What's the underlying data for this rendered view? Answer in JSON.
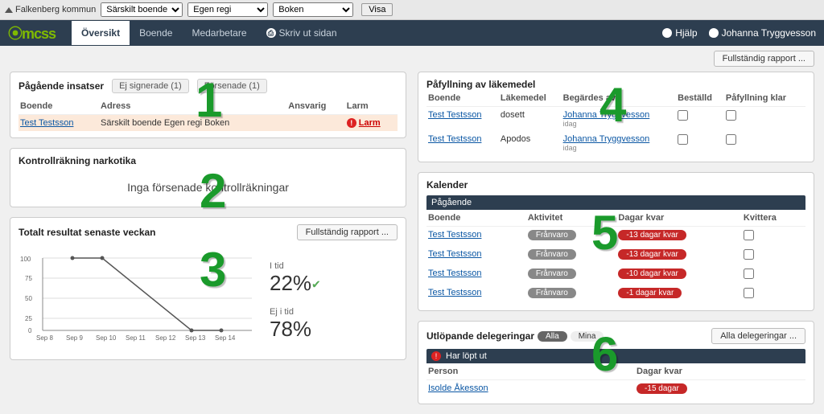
{
  "top": {
    "crumb": "Falkenberg kommun",
    "sel1": "Särskilt boende",
    "sel2": "Egen regi",
    "sel3": "Boken",
    "visa": "Visa"
  },
  "nav": {
    "logo": "⦿mcss",
    "tab1": "Översikt",
    "tab2": "Boende",
    "tab3": "Medarbetare",
    "tab4": "Skriv ut sidan",
    "help": "Hjälp",
    "user": "Johanna Tryggvesson"
  },
  "top_report": "Fullständig rapport ...",
  "p1": {
    "title": "Pågående insatser",
    "bt1": "Ej signerade (1)",
    "bt2": "Försenade (1)",
    "h_boende": "Boende",
    "h_adress": "Adress",
    "h_ansv": "Ansvarig",
    "h_larm": "Larm",
    "name": "Test Testsson",
    "addr": "Särskilt boende Egen regi Boken",
    "larm": "Larm"
  },
  "p2": {
    "title": "Kontrollräkning narkotika",
    "msg": "Inga försenade kontrollräkningar"
  },
  "p3": {
    "title": "Totalt resultat senaste veckan",
    "btn": "Fullständig rapport ...",
    "l1": "I tid",
    "v1": "22%",
    "l2": "Ej i tid",
    "v2": "78%"
  },
  "p4": {
    "title": "Påfyllning av läkemedel",
    "h1": "Boende",
    "h2": "Läkemedel",
    "h3": "Begärdes av",
    "h4": "Beställd",
    "h5": "Påfyllning klar",
    "name": "Test Testsson",
    "med1": "dosett",
    "med2": "Apodos",
    "by": "Johanna Tryggvesson",
    "sub": "idag"
  },
  "p5": {
    "title": "Kalender",
    "sect": "Pågående",
    "h1": "Boende",
    "h2": "Aktivitet",
    "h3": "Dagar kvar",
    "h4": "Kvittera",
    "name": "Test Testsson",
    "act": "Frånvaro",
    "d1": "-13 dagar kvar",
    "d2": "-13 dagar kvar",
    "d3": "-10 dagar kvar",
    "d4": "-1 dagar kvar"
  },
  "p6": {
    "title": "Utlöpande delegeringar",
    "t1": "Alla",
    "t2": "Mina",
    "btn": "Alla delegeringar ...",
    "sect": "Har löpt ut",
    "h1": "Person",
    "h2": "Dagar kvar",
    "name": "Isolde Åkesson",
    "d": "-15 dagar"
  },
  "chart_data": {
    "type": "line",
    "title": "Totalt resultat senaste veckan",
    "xlabel": "",
    "ylabel": "",
    "ylim": [
      0,
      100
    ],
    "categories": [
      "Sep 8",
      "Sep 9",
      "Sep 10",
      "Sep 11",
      "Sep 12",
      "Sep 13",
      "Sep 14"
    ],
    "values": [
      null,
      100,
      100,
      null,
      null,
      0,
      0
    ]
  },
  "numbers": {
    "n1": "1",
    "n2": "2",
    "n3": "3",
    "n4": "4",
    "n5": "5",
    "n6": "6"
  }
}
